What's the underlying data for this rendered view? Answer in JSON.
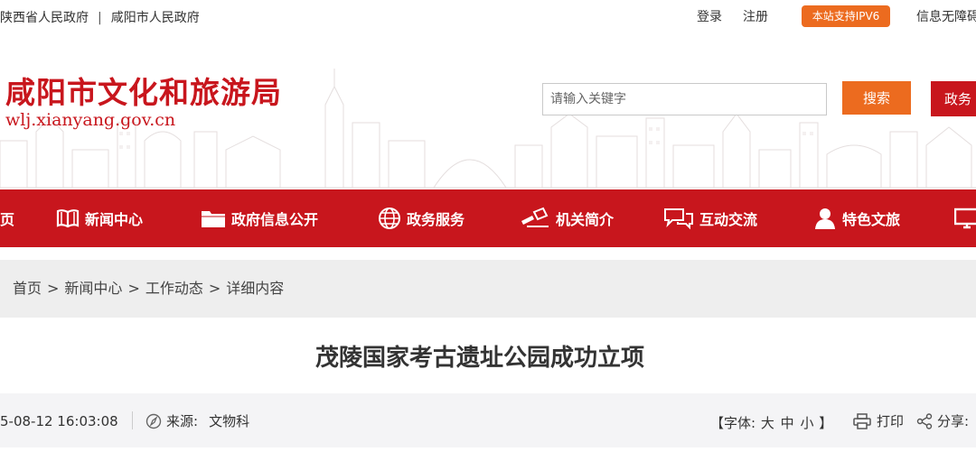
{
  "topbar": {
    "province_link": "陕西省人民政府",
    "separator": "|",
    "city_link": "咸阳市人民政府",
    "login": "登录",
    "register": "注册",
    "ipv6_badge": "本站支持IPV6",
    "accessibility": "信息无障碍"
  },
  "header": {
    "site_name": "咸阳市文化和旅游局",
    "site_url": "wlj.xianyang.gov.cn",
    "search_placeholder": "请输入关键字",
    "search_button": "搜索",
    "gov_button": "政务"
  },
  "nav": {
    "items": [
      {
        "label": "页",
        "icon": "home-icon"
      },
      {
        "label": "新闻中心",
        "icon": "book-icon"
      },
      {
        "label": "政府信息公开",
        "icon": "folder-icon"
      },
      {
        "label": "政务服务",
        "icon": "globe-icon"
      },
      {
        "label": "机关简介",
        "icon": "pen-icon"
      },
      {
        "label": "互动交流",
        "icon": "chat-icon"
      },
      {
        "label": "特色文旅",
        "icon": "user-icon"
      },
      {
        "label": "",
        "icon": "monitor-icon"
      }
    ]
  },
  "breadcrumb": {
    "items": [
      "首页",
      "新闻中心",
      "工作动态",
      "详细内容"
    ],
    "separator": ">"
  },
  "article": {
    "title": "茂陵国家考古遗址公园成功立项",
    "time": "5-08-12 16:03:08",
    "source_label": "来源:",
    "source_value": "文物科",
    "font_size_open": "【字体:",
    "font_large": "大",
    "font_medium": "中",
    "font_small": "小",
    "font_size_close": "】",
    "print": "打印",
    "share": "分享:"
  },
  "colors": {
    "primary_red": "#c8161d",
    "accent_orange": "#ec6b1f",
    "breadcrumb_bg": "#eeeeee"
  }
}
